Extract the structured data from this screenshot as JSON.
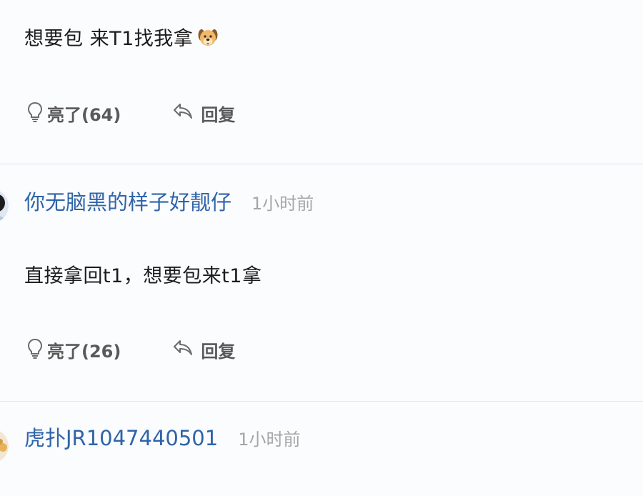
{
  "comments": [
    {
      "text": "想要包 来T1找我拿",
      "emoji": "dog-face",
      "like_label": "亮了(64)",
      "reply_label": "回复"
    },
    {
      "username": "你无脑黑的样子好靓仔",
      "time": "1小时前",
      "text": "直接拿回t1，想要包来t1拿",
      "like_label": "亮了(26)",
      "reply_label": "回复"
    },
    {
      "username": "虎扑JR1047440501",
      "time": "1小时前"
    }
  ],
  "colors": {
    "background": "#fbfcfe",
    "username": "#2f64a8",
    "action_text": "#595959",
    "time": "#a6a6a6",
    "divider": "#e3e5ea"
  }
}
